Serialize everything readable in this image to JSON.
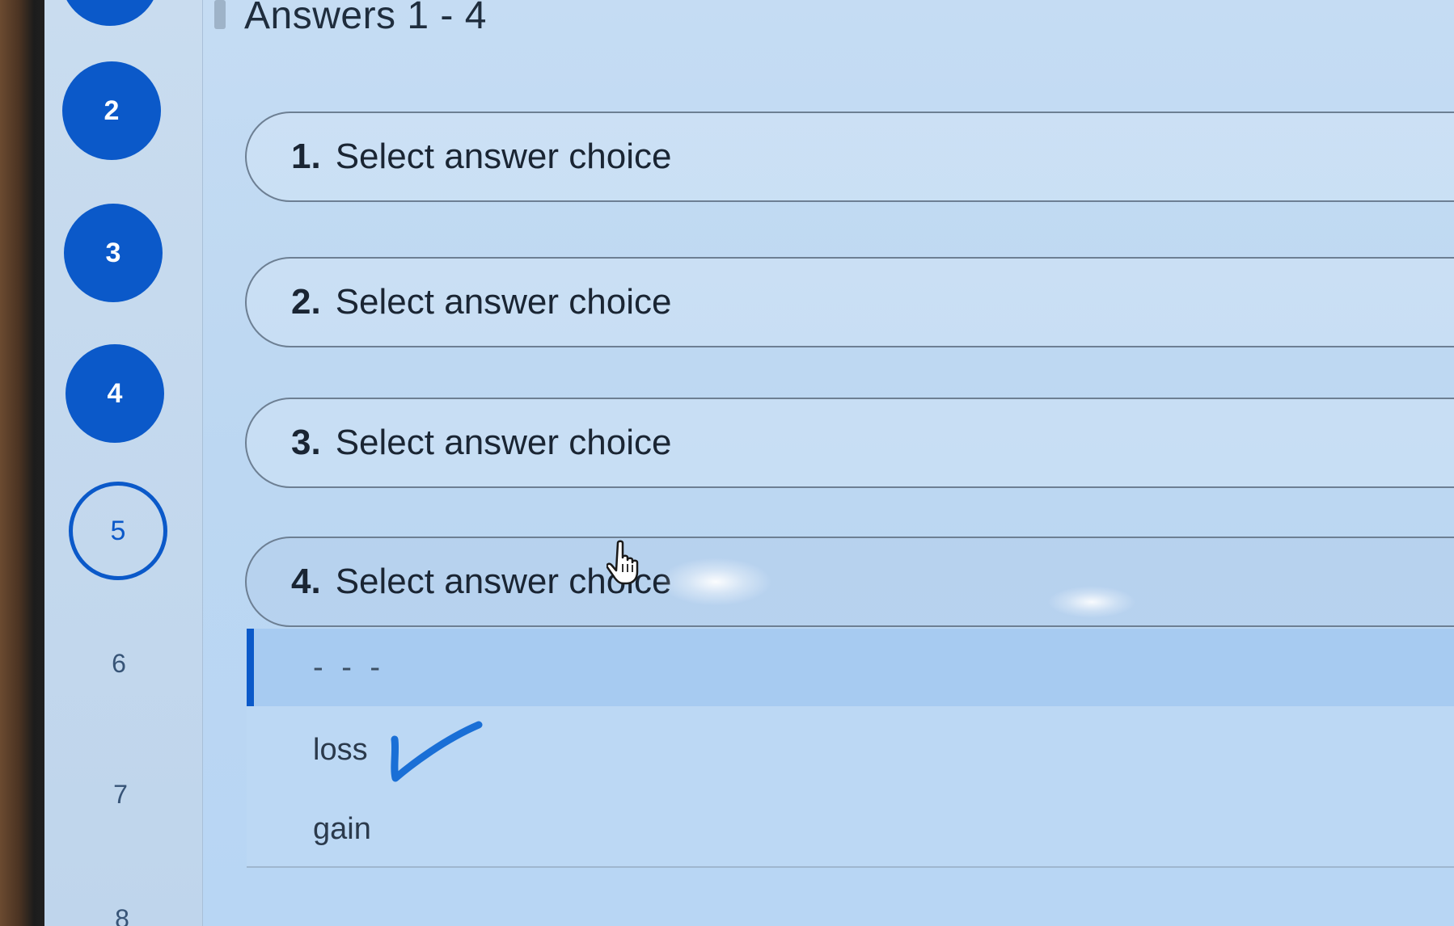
{
  "heading": "Answers 1 - 4",
  "question_nav": [
    {
      "label": "2",
      "state": "answered"
    },
    {
      "label": "3",
      "state": "answered"
    },
    {
      "label": "4",
      "state": "answered"
    },
    {
      "label": "5",
      "state": "current"
    },
    {
      "label": "6",
      "state": "unanswered"
    },
    {
      "label": "7",
      "state": "unanswered"
    },
    {
      "label": "8",
      "state": "unanswered"
    }
  ],
  "answers": [
    {
      "number": "1.",
      "placeholder": "Select answer choice"
    },
    {
      "number": "2.",
      "placeholder": "Select answer choice"
    },
    {
      "number": "3.",
      "placeholder": "Select answer choice"
    },
    {
      "number": "4.",
      "placeholder": "Select answer choice"
    }
  ],
  "dropdown_options": [
    "- - -",
    "loss",
    "gain"
  ],
  "colors": {
    "accent": "#0b59c9",
    "screen_bg": "#bcd7f2",
    "handwritten_check": "#1a6fd6"
  },
  "icons": {
    "cursor": "hand-pointer-icon",
    "annotation": "handwritten-checkmark-icon"
  }
}
